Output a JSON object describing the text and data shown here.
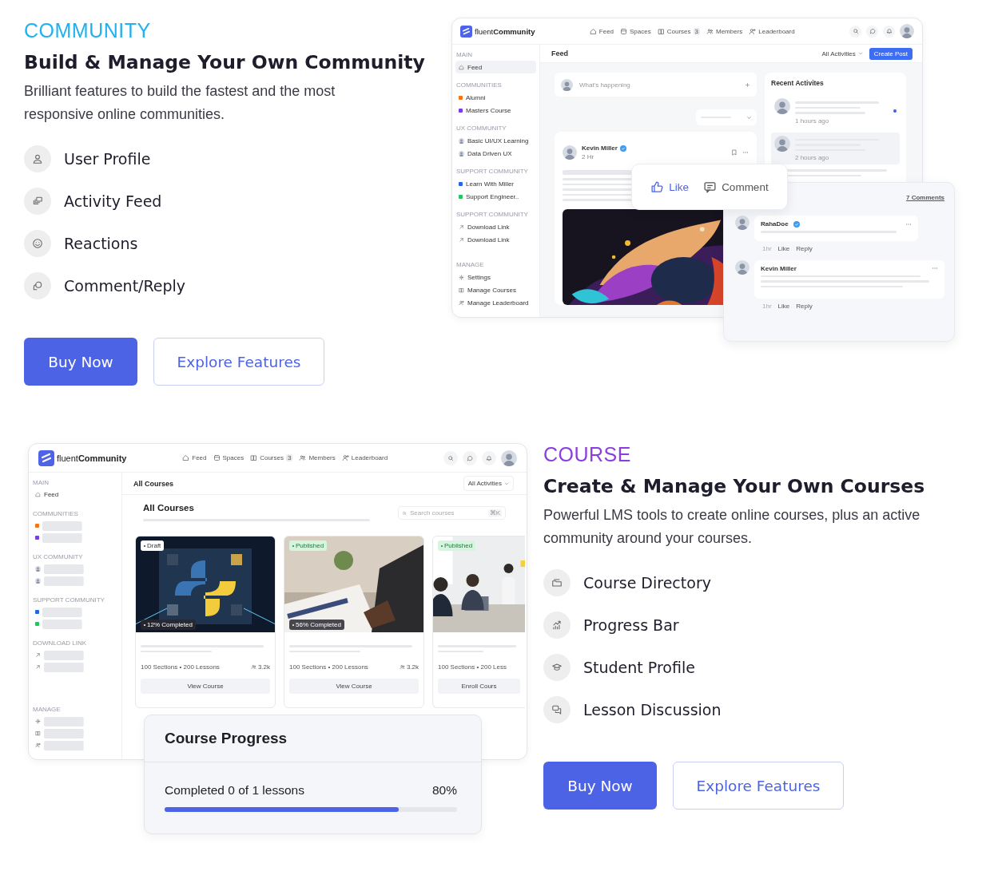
{
  "community": {
    "eyebrow": "COMMUNITY",
    "title": "Build & Manage Your Own Community",
    "description": "Brilliant features to build the fastest and the most responsive online communities.",
    "features": [
      "User Profile",
      "Activity Feed",
      "Reactions",
      "Comment/Reply"
    ],
    "buttons": {
      "primary": "Buy Now",
      "secondary": "Explore Features"
    },
    "mockup": {
      "nav": {
        "logo": "fluent**Community**",
        "items": [
          {
            "label": "Feed"
          },
          {
            "label": "Spaces"
          },
          {
            "label": "Courses",
            "badge": "3"
          },
          {
            "label": "Members"
          },
          {
            "label": "Leaderboard"
          }
        ]
      },
      "sidebar": [
        {
          "heading": "MAIN",
          "items": [
            {
              "kind": "home",
              "label": "Feed",
              "selected": true
            }
          ]
        },
        {
          "heading": "COMMUNITIES",
          "items": [
            {
              "kind": "square",
              "label": "Alumni",
              "color": "#f97316",
              "selected": false
            },
            {
              "kind": "square",
              "label": "Masters Course",
              "color": "#7c3aed",
              "selected": false
            }
          ]
        },
        {
          "heading": "UX COMMUNITY",
          "items": [
            {
              "kind": "avatar",
              "label": "Basic UI/UX Learning",
              "selected": false
            },
            {
              "kind": "avatar",
              "label": "Data Driven UX",
              "selected": false
            }
          ]
        },
        {
          "heading": "SUPPORT COMMUNITY",
          "items": [
            {
              "kind": "square",
              "label": "Learn With Miller",
              "color": "#2563eb",
              "selected": false
            },
            {
              "kind": "square",
              "label": "Support Engineer..",
              "color": "#22c55e",
              "selected": false
            }
          ]
        },
        {
          "heading": "SUPPORT COMMUNITY",
          "items": [
            {
              "kind": "arrow",
              "label": "Download Link",
              "selected": false
            },
            {
              "kind": "arrow",
              "label": "Download Link",
              "selected": false
            }
          ]
        },
        {
          "heading": "MANAGE",
          "items": [
            {
              "kind": "gear",
              "label": "Settings",
              "selected": false
            },
            {
              "kind": "courses",
              "label": "Manage Courses",
              "selected": false
            },
            {
              "kind": "leaderboard",
              "label": "Manage Leaderboard",
              "selected": false
            }
          ]
        }
      ],
      "header": {
        "title": "Feed",
        "filter": "All Activities",
        "action": "Create Post"
      },
      "composer": {
        "placeholder": "What's happening"
      },
      "post": {
        "author": "Kevin Miller",
        "verified": true,
        "time": "2 Hr"
      },
      "recent": {
        "title": "Recent Activites",
        "items": [
          {
            "time": "1 hours ago",
            "unread": true,
            "selected": false
          },
          {
            "time": "2 hours ago",
            "unread": false,
            "selected": true
          }
        ]
      },
      "reactions": {
        "like": "Like",
        "comment": "Comment"
      },
      "comments": {
        "count": "7 Comments",
        "items": [
          {
            "author": "RahaDoe",
            "verified": true,
            "time": "1hr",
            "like": "Like",
            "reply": "Reply"
          },
          {
            "author": "Kevin Miller",
            "verified": false,
            "time": "1hr",
            "like": "Like",
            "reply": "Reply"
          }
        ]
      }
    }
  },
  "course": {
    "eyebrow": "COURSE",
    "title": "Create & Manage Your Own Courses",
    "description": "Powerful LMS tools to create online courses, plus an active community around your courses.",
    "features": [
      "Course Directory",
      "Progress Bar",
      "Student Profile",
      "Lesson Discussion"
    ],
    "buttons": {
      "primary": "Buy Now",
      "secondary": "Explore Features"
    },
    "mockup": {
      "nav": {
        "logo": "fluent**Community**",
        "items": [
          {
            "label": "Feed"
          },
          {
            "label": "Spaces"
          },
          {
            "label": "Courses",
            "badge": "3"
          },
          {
            "label": "Members"
          },
          {
            "label": "Leaderboard"
          }
        ]
      },
      "sidebar": [
        {
          "heading": "MAIN",
          "items": [
            {
              "kind": "home",
              "label": "Feed"
            }
          ]
        },
        {
          "heading": "COMMUNITIES",
          "items": [
            {
              "kind": "square",
              "color": "#f97316"
            },
            {
              "kind": "square",
              "color": "#7c3aed"
            }
          ]
        },
        {
          "heading": "UX COMMUNITY",
          "items": [
            {
              "kind": "avatar"
            },
            {
              "kind": "avatar"
            }
          ]
        },
        {
          "heading": "SUPPORT COMMUNITY",
          "items": [
            {
              "kind": "square",
              "color": "#2563eb"
            },
            {
              "kind": "square",
              "color": "#22c55e"
            }
          ]
        },
        {
          "heading": "DOWNLOAD LINK",
          "items": [
            {
              "kind": "arrow"
            },
            {
              "kind": "arrow"
            }
          ]
        },
        {
          "heading": "MANAGE",
          "items": [
            {
              "kind": "gear"
            },
            {
              "kind": "courses"
            },
            {
              "kind": "leaderboard"
            }
          ]
        }
      ],
      "header": {
        "title": "All Courses",
        "filter": "All Activities"
      },
      "heading": "All Courses",
      "search": {
        "placeholder": "Search courses",
        "shortcut": "⌘K"
      },
      "cards": [
        {
          "status": "Draft",
          "published": false,
          "progress": "12% Completed",
          "meta": "100 Sections • 200 Lessons",
          "members": "3.2k",
          "action": "View Course"
        },
        {
          "status": "Published",
          "published": true,
          "progress": "56% Completed",
          "meta": "100 Sections • 200 Lessons",
          "members": "3.2k",
          "action": "View Course"
        },
        {
          "status": "Published",
          "published": true,
          "meta": "100 Sections • 200 Less",
          "action": "Enroll Cours"
        }
      ]
    },
    "progress": {
      "title": "Course Progress",
      "label": "Completed 0 of 1 lessons",
      "percent": "80%",
      "level": 0.8
    }
  }
}
